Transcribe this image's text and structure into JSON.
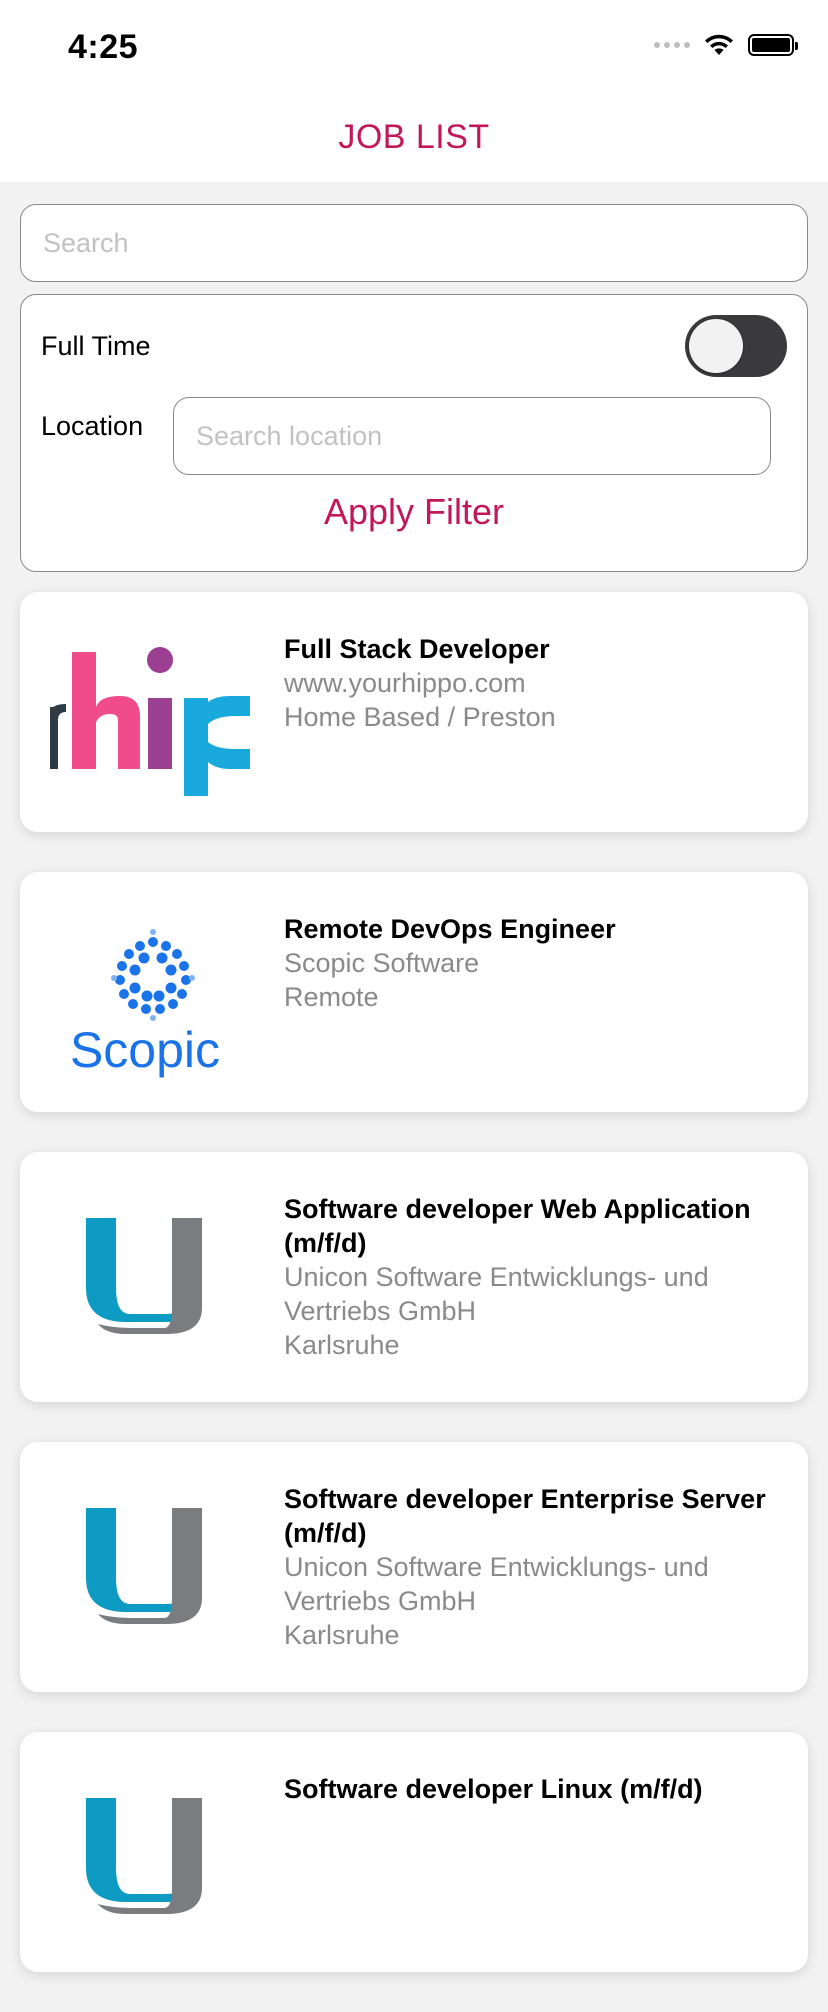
{
  "status_bar": {
    "time": "4:25"
  },
  "header": {
    "title": "JOB LIST"
  },
  "search": {
    "placeholder": "Search",
    "value": ""
  },
  "filter": {
    "full_time_label": "Full Time",
    "full_time_on": false,
    "location_label": "Location",
    "location_placeholder": "Search location",
    "location_value": "",
    "apply_label": "Apply Filter"
  },
  "colors": {
    "accent": "#c2185b",
    "toggle_track": "#3a3a3c",
    "secondary_text": "#8a8a8a"
  },
  "jobs": [
    {
      "title": "Full Stack Developer",
      "company": "www.yourhippo.com",
      "location": "Home Based / Preston",
      "logo": "hippo-logo"
    },
    {
      "title": "Remote DevOps Engineer",
      "company": "Scopic Software",
      "location": "Remote",
      "logo": "scopic-logo",
      "logo_text": "Scopic"
    },
    {
      "title": "Software developer Web Application (m/f/d)",
      "company": "Unicon Software Entwicklungs- und Vertriebs GmbH",
      "location": "Karlsruhe",
      "logo": "unicon-logo"
    },
    {
      "title": "Software developer Enterprise Server (m/f/d)",
      "company": "Unicon Software Entwicklungs- und Vertriebs GmbH",
      "location": "Karlsruhe",
      "logo": "unicon-logo"
    },
    {
      "title": "Software developer Linux (m/f/d)",
      "company": "",
      "location": "",
      "logo": "unicon-logo"
    }
  ]
}
